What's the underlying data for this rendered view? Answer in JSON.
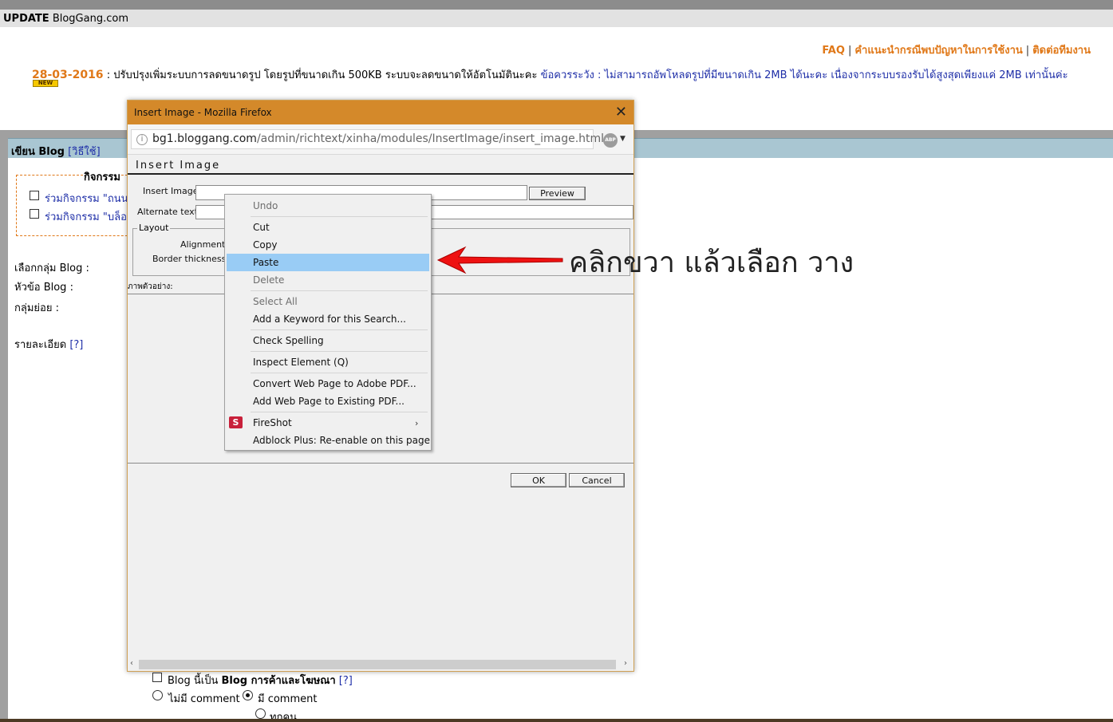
{
  "update_bar": {
    "bold": "UPDATE",
    "site": " BlogGang.com"
  },
  "top_links": {
    "faq": "FAQ",
    "sep": "|",
    "advice": "คำแนะนำกรณีพบปัญหาในการใช้งาน",
    "contact": "ติดต่อทีมงาน"
  },
  "news": {
    "date": "28-03-2016",
    "text": " : ปรับปรุงเพิ่มระบบการลดขนาดรูป โดยรูปที่ขนาดเกิน 500KB ระบบจะลดขนาดให้อัตโนมัตินะคะ ",
    "warning": "ข้อควรระวัง : ไม่สามารถอัพโหลดรูปที่มีขนาดเกิน 2MB ได้นะคะ เนื่องจากระบบรองรับได้สูงสุดเพียงแค่ 2MB เท่านั้นค่ะ",
    "badge": "NEW"
  },
  "write_header": {
    "title": "เขียน Blog",
    "help": "[วิธีใช้]"
  },
  "activity": {
    "legend": "กิจกรรม",
    "items": [
      "ร่วมกิจกรรม \"ถนน",
      "ร่วมกิจกรรม \"บล็อ"
    ]
  },
  "form_labels": {
    "group": "เลือกกลุ่ม Blog :",
    "title": "หัวข้อ Blog :",
    "subgroup": "กลุ่มย่อย :",
    "detail": "รายละเอียด",
    "detail_help": "[?]"
  },
  "bottom_options": {
    "commercial_pre": "Blog นี้เป็น ",
    "commercial_bold": "Blog การค้าและโฆษณา",
    "commercial_help": "[?]",
    "no_comment": "ไม่มี comment",
    "has_comment": "มี comment",
    "everyone": "ทุกคน"
  },
  "popup": {
    "window_title": "Insert Image - Mozilla Firefox",
    "close": "✕",
    "url_host": "bg1.bloggang.com",
    "url_path": "/admin/richtext/xinha/modules/InsertImage/insert_image.html",
    "abp": "ABP",
    "heading": "Insert Image",
    "insert_image_label": "Insert Image:",
    "preview_button": "Preview",
    "alt_label": "Alternate text:",
    "layout_legend": "Layout",
    "alignment_label": "Alignment:",
    "border_label": "Border thickness:",
    "preview_label": "ภาพตัวอย่าง:",
    "ok_button": "OK",
    "cancel_button": "Cancel"
  },
  "context_menu": {
    "undo": "Undo",
    "cut": "Cut",
    "copy": "Copy",
    "paste": "Paste",
    "delete": "Delete",
    "select_all": "Select All",
    "add_keyword": "Add a Keyword for this Search...",
    "check_spelling": "Check Spelling",
    "inspect": "Inspect Element (Q)",
    "convert_pdf": "Convert Web Page to Adobe PDF...",
    "add_pdf": "Add Web Page to Existing PDF...",
    "fireshot": "FireShot",
    "adblock": "Adblock Plus: Re-enable on this page"
  },
  "annotation": {
    "text": "คลิกขวา แล้วเลือก วาง",
    "arrow_color": "#ee1111"
  },
  "colors": {
    "accent_orange": "#e07818",
    "link_blue": "#1f2fa8",
    "titlebar": "#d4892a",
    "menu_highlight": "#99ccf5"
  }
}
